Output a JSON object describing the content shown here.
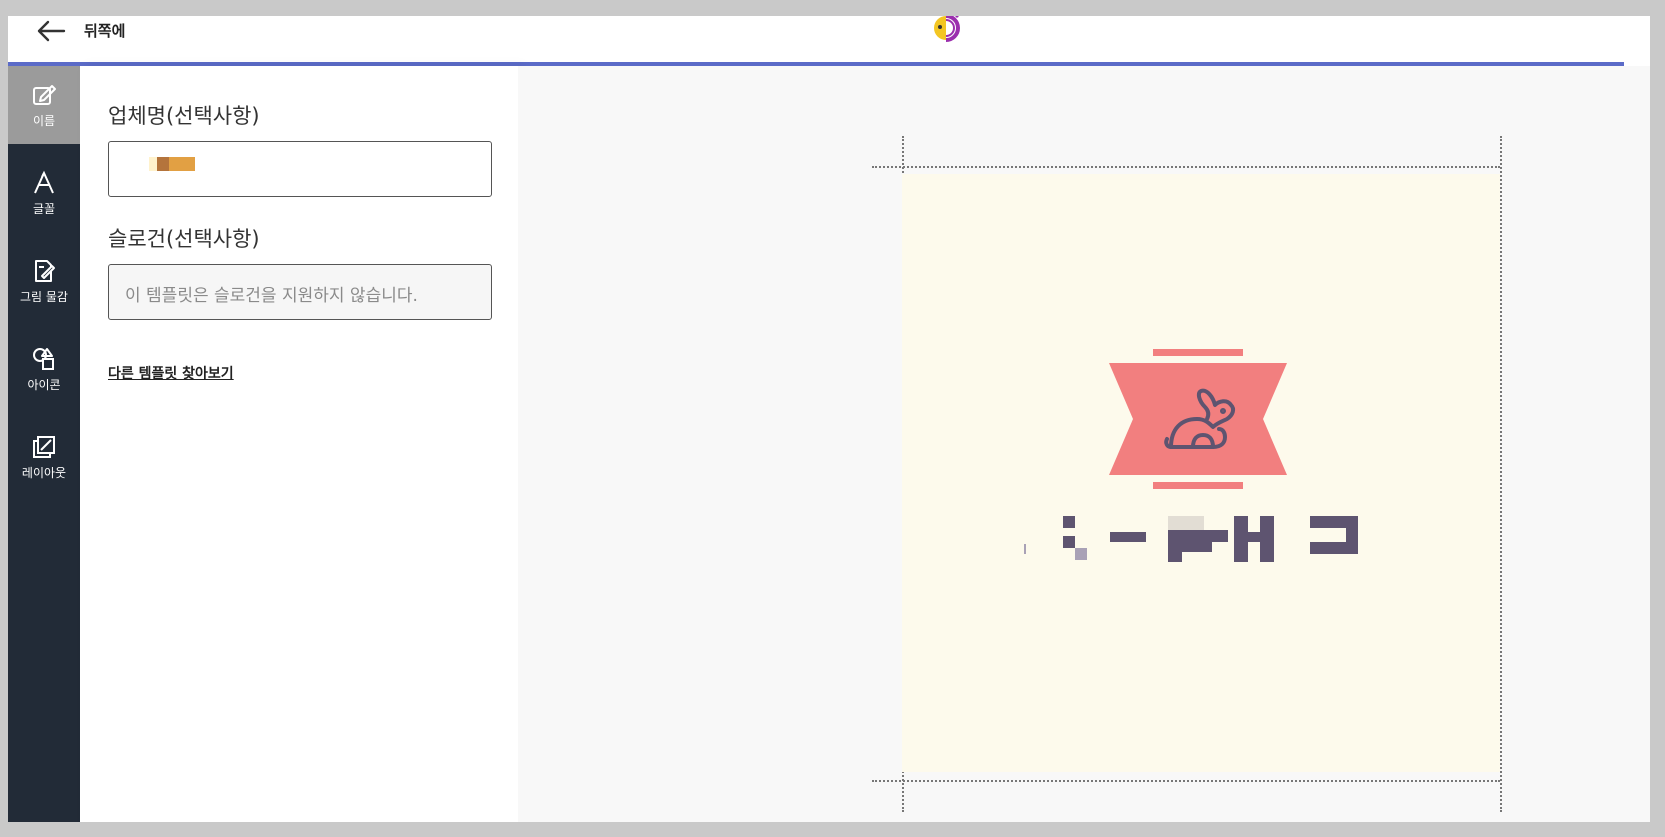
{
  "topbar": {
    "back_label": "뒤쪽에",
    "progress_color": "#5b6bc8"
  },
  "rail": {
    "items": [
      {
        "label": "이름",
        "icon": "edit-icon",
        "active": true
      },
      {
        "label": "글꼴",
        "icon": "font-icon",
        "active": false
      },
      {
        "label": "그림 물감",
        "icon": "paint-icon",
        "active": false
      },
      {
        "label": "아이콘",
        "icon": "shapes-icon",
        "active": false
      },
      {
        "label": "레이아웃",
        "icon": "layout-icon",
        "active": false
      }
    ]
  },
  "form": {
    "company_label": "업체명(선택사항)",
    "company_value": "",
    "slogan_label": "슬로건(선택사항)",
    "slogan_placeholder": "이 템플릿은 슬로건을 지원하지 않습니다.",
    "browse_link": "다른 템플릿 찾아보기"
  },
  "preview": {
    "background_color": "#fdfaec",
    "banner_color": "#f27f7f",
    "icon": "rabbit-icon",
    "text_color": "#5e5470"
  }
}
